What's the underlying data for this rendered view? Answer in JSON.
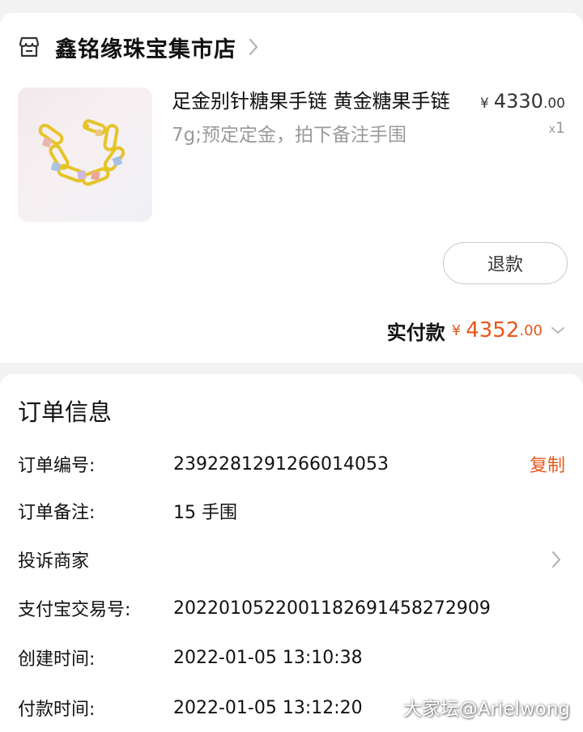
{
  "store": {
    "name": "鑫铭缘珠宝集市店",
    "icon": "store-icon"
  },
  "product": {
    "title": "足金别针糖果手链 黄金糖果手链",
    "spec": "7g;预定定金，拍下备注手围",
    "price_symbol": "¥",
    "price_int": "4330",
    "price_dec": ".00",
    "qty_prefix": "x",
    "qty": "1"
  },
  "actions": {
    "refund_label": "退款"
  },
  "payment": {
    "paid_label": "实付款",
    "symbol": "¥",
    "amount_int": "4352",
    "amount_dec": ".00",
    "accent_color": "#e4581b"
  },
  "order_info": {
    "title": "订单信息",
    "order_no_label": "订单编号:",
    "order_no": "2392281291266014053",
    "copy_label": "复制",
    "remark_label": "订单备注:",
    "remark": "15 手围",
    "complaint_label": "投诉商家",
    "alipay_label": "支付宝交易号:",
    "alipay_no": "2022010522001182691458272909",
    "created_label": "创建时间:",
    "created_time": "2022-01-05 13:10:38",
    "paid_time_label": "付款时间:",
    "paid_time": "2022-01-05 13:12:20"
  },
  "watermark": "大家坛@Arielwong"
}
